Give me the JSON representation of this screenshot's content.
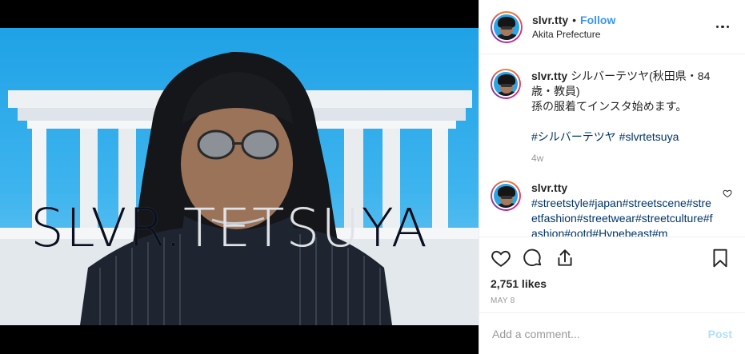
{
  "media": {
    "overlay_text_a": "SLVR.",
    "overlay_text_b": "TETSU",
    "overlay_text_c": "YA"
  },
  "header": {
    "username": "slvr.tty",
    "separator": "•",
    "follow_label": "Follow",
    "location": "Akita Prefecture"
  },
  "caption": {
    "username": "slvr.tty",
    "text_line1": "シルバーテツヤ(秋田県・84歳・教員)",
    "text_line2": "孫の服着てインスタ始めます。",
    "hashtags": "#シルバーテツヤ #slvrtetsuya",
    "time": "4w"
  },
  "comment": {
    "username": "slvr.tty",
    "hashtags": "#streetstyle#japan#streetscene#streetfashion#streetwear#streetculture#fashion#ootd#Hypebeast#m"
  },
  "actions": {
    "likes": "2,751 likes",
    "date": "MAY 8"
  },
  "add_comment": {
    "placeholder": "Add a comment...",
    "post_label": "Post"
  },
  "colors": {
    "link_blue": "#3897f0",
    "hashtag": "#003569",
    "muted": "#999999",
    "post_disabled": "#b2dffc"
  }
}
